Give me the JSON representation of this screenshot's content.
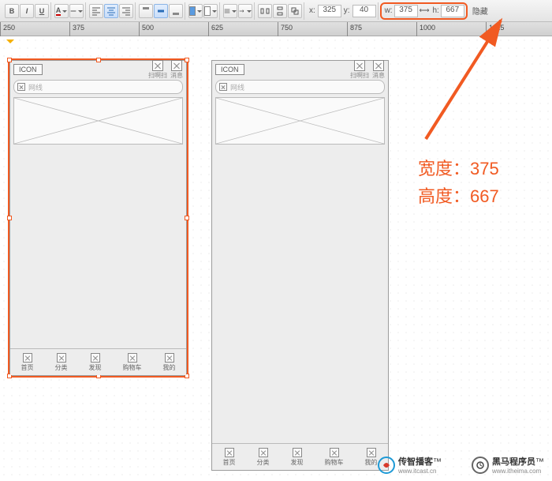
{
  "toolbar": {
    "bold": "B",
    "italic": "I",
    "underline": "U",
    "coords": {
      "x_label": "x:",
      "x_value": "325",
      "y_label": "y:",
      "y_value": "40"
    },
    "dims": {
      "w_label": "w:",
      "w_value": "375",
      "h_label": "h:",
      "h_value": "667"
    },
    "hide_label": "隐藏"
  },
  "ruler": {
    "start": 250,
    "step": 125,
    "count": 8
  },
  "mockup": {
    "icon_label": "ICON",
    "header_labels": [
      "扫啊扫",
      "消息"
    ],
    "search_placeholder": "网线",
    "tabs": [
      "首页",
      "分类",
      "发现",
      "购物车",
      "我的"
    ]
  },
  "annotations": {
    "width_line": "宽度：375",
    "height_line": "高度：667"
  },
  "watermarks": {
    "left": {
      "name": "传智播客",
      "url": "www.itcast.cn"
    },
    "right": {
      "name": "黑马程序员",
      "url": "www.itheima.com"
    }
  }
}
